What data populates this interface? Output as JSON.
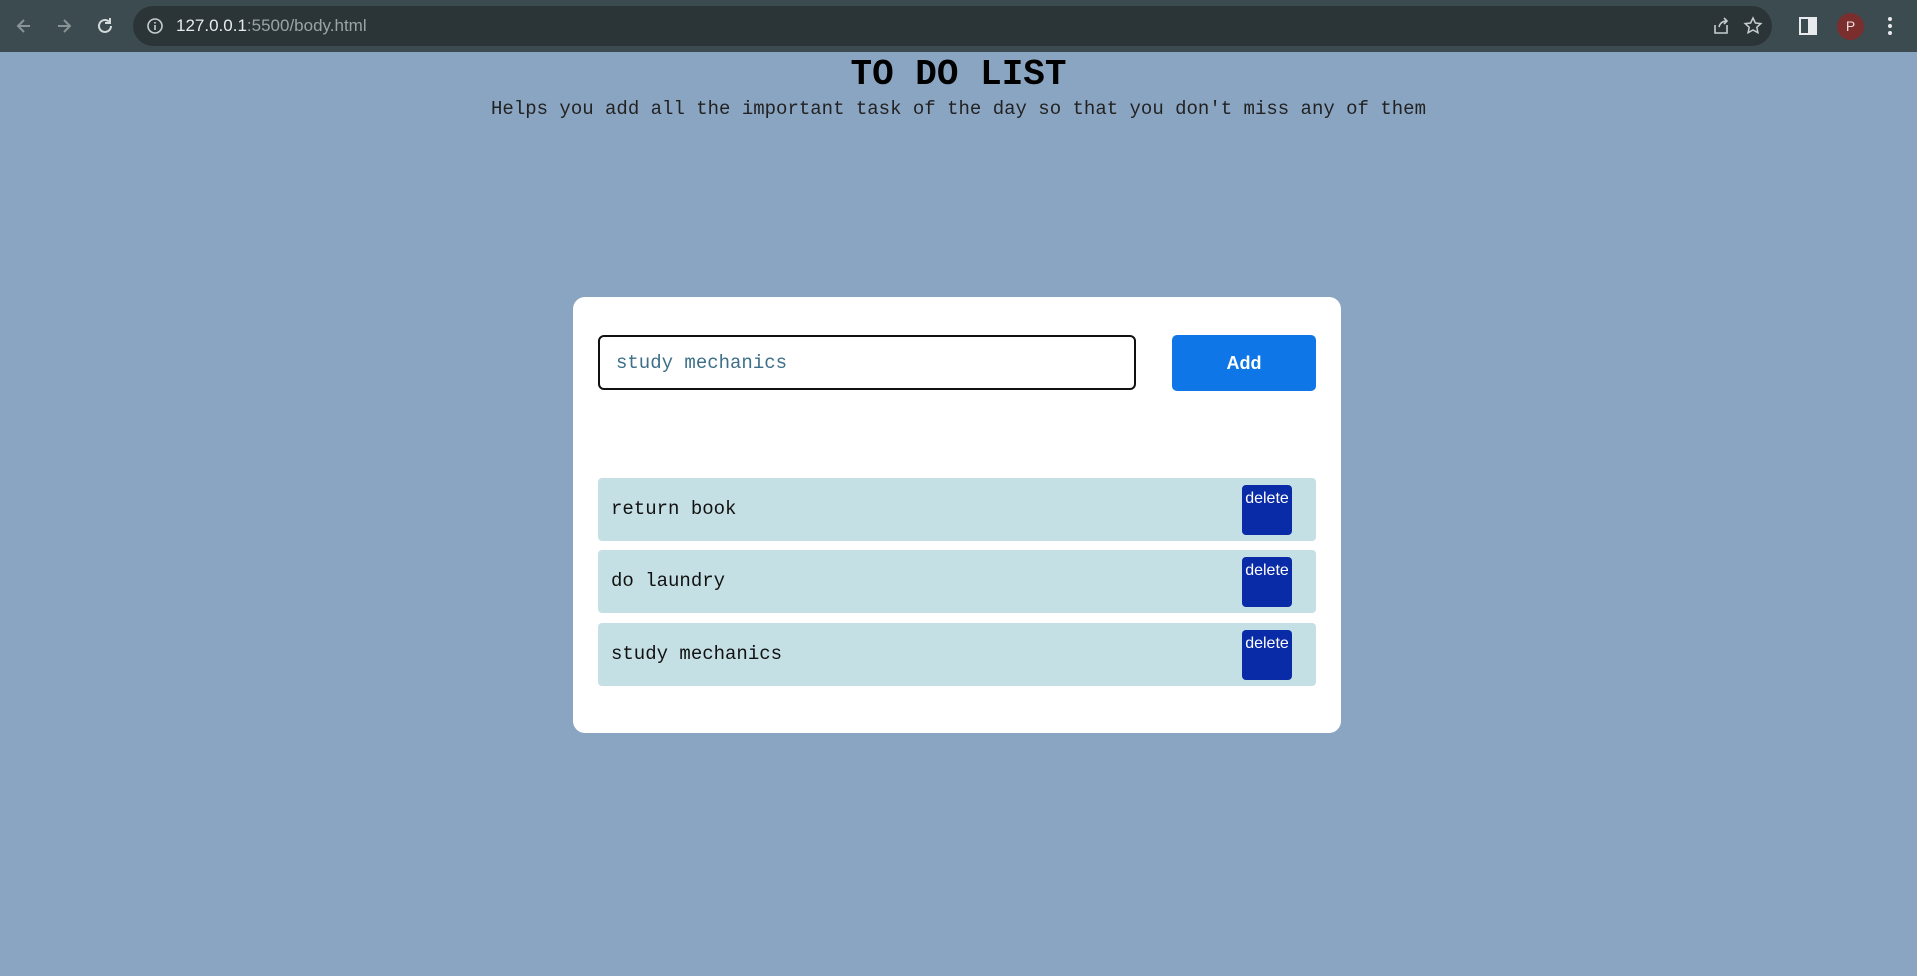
{
  "browser": {
    "url_host": "127.0.0.1",
    "url_path": ":5500/body.html",
    "profile_initial": "P"
  },
  "page": {
    "title": "TO DO LIST",
    "subtitle": "Helps you add all the important task of the day so that you don't miss any of them"
  },
  "form": {
    "input_value": "study mechanics",
    "add_label": "Add"
  },
  "tasks": [
    {
      "text": "return book",
      "delete_label": "delete"
    },
    {
      "text": "do laundry",
      "delete_label": "delete"
    },
    {
      "text": "study mechanics",
      "delete_label": "delete"
    }
  ],
  "colors": {
    "page_background": "#8aa5c2",
    "add_button": "#0f76e8",
    "delete_button": "#0a2ba8",
    "task_row": "#c5e0e5"
  }
}
